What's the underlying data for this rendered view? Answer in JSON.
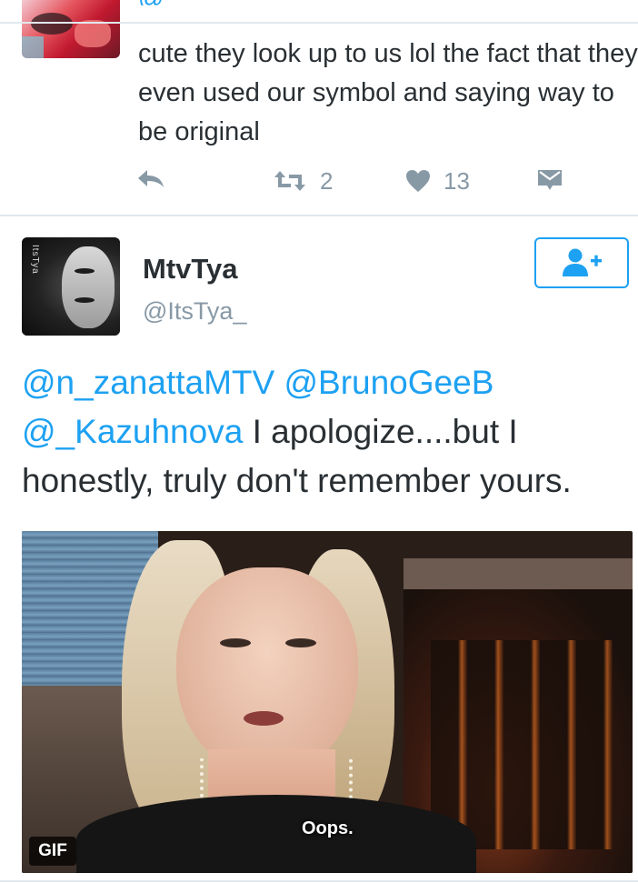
{
  "tweet1": {
    "cut_handle": "@",
    "text": "cute they look up to us lol the fact that they even used our symbol and saying way to be original",
    "retweet_count": "2",
    "like_count": "13"
  },
  "tweet2": {
    "display_name": "MtvTya",
    "handle": "@ItsTya_",
    "avatar_text": "ItsTya",
    "mentions": [
      "@n_zanattaMTV",
      "@BrunoGeeB",
      "@_Kazuhnova"
    ],
    "text": " I apologize....but I honestly, truly don't remember yours.",
    "media": {
      "caption": "Oops.",
      "badge": "GIF"
    }
  },
  "colors": {
    "accent": "#1da1f2",
    "muted": "#8899a6",
    "text": "#292f33",
    "divider": "#e1e8ed"
  },
  "icons": {
    "reply": "reply-icon",
    "retweet": "retweet-icon",
    "like": "heart-icon",
    "dm": "envelope-icon",
    "follow": "add-user-icon"
  }
}
